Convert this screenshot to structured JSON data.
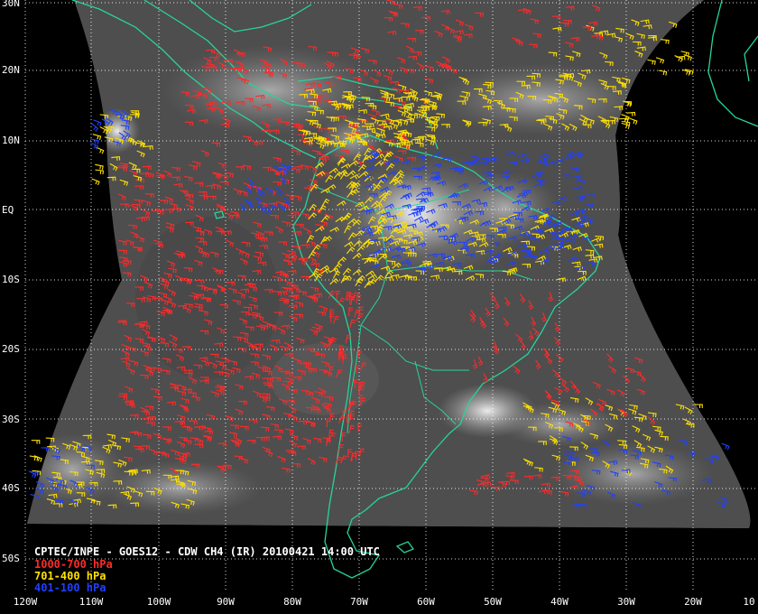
{
  "product": {
    "title": "CPTEC/INPE - GOES12 - CDW CH4 (IR) 20100421 14:00 UTC",
    "legend": [
      {
        "label": "1000-700 hPa",
        "color": "#ff2a2a"
      },
      {
        "label": "701-400 hPa",
        "color": "#ffe100"
      },
      {
        "label": "401-100 hPa",
        "color": "#2040ff"
      }
    ]
  },
  "colors": {
    "coastline": "#26d49a",
    "grid": "#ffffff",
    "background": "#000000"
  },
  "latitude_labels": [
    "30N",
    "20N",
    "10N",
    "EQ",
    "10S",
    "20S",
    "30S",
    "40S",
    "50S"
  ],
  "longitude_labels": [
    "120W",
    "110W",
    "100W",
    "90W",
    "80W",
    "70W",
    "60W",
    "50W",
    "40W",
    "30W",
    "20W",
    "10"
  ]
}
